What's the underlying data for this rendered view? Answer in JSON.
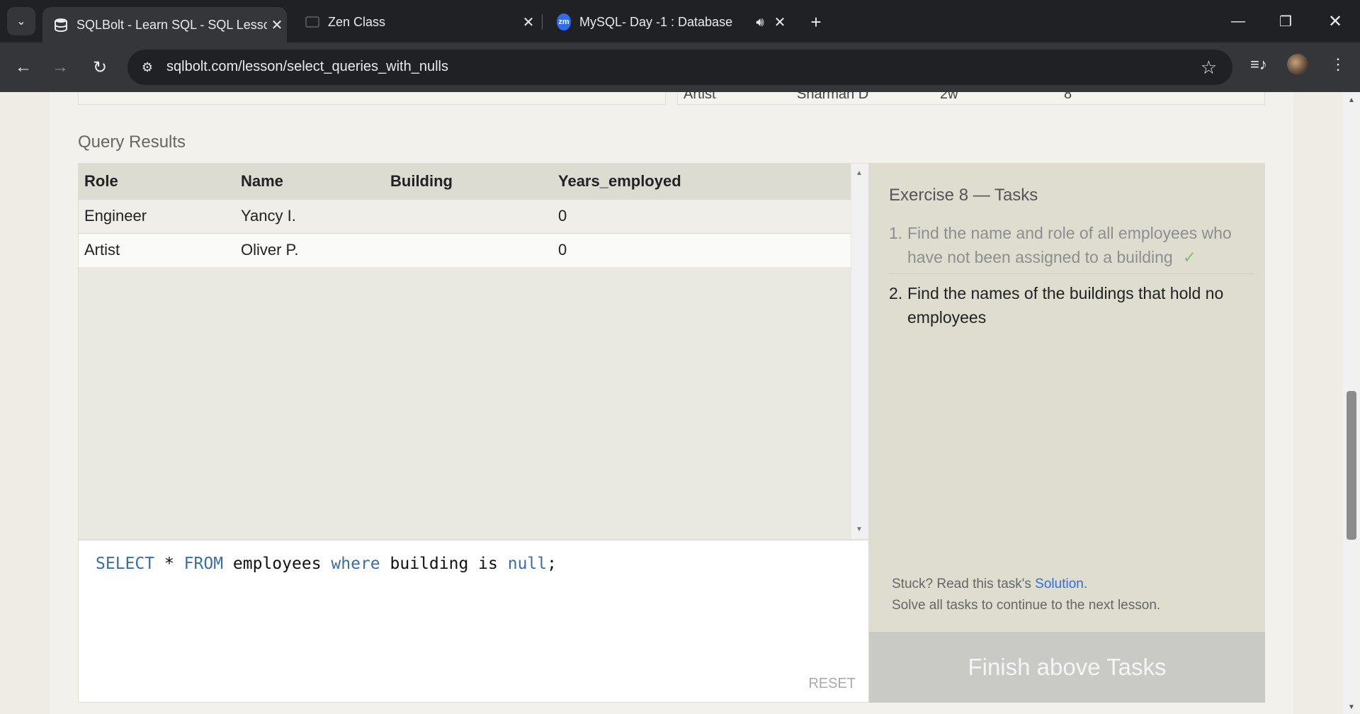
{
  "browser": {
    "tabs": [
      {
        "title": "SQLBolt - Learn SQL - SQL Lesso",
        "active": true
      },
      {
        "title": "Zen Class",
        "active": false
      },
      {
        "title": "MySQL- Day -1 : Database",
        "active": false
      }
    ],
    "url": "sqlbolt.com/lesson/select_queries_with_nulls",
    "zoom_favicon_label": "zm"
  },
  "previous_table": {
    "partial_row": [
      "Artist",
      "Sharman D",
      "2w",
      "8"
    ]
  },
  "results": {
    "label": "Query Results",
    "columns": [
      "Role",
      "Name",
      "Building",
      "Years_employed"
    ],
    "rows": [
      [
        "Engineer",
        "Yancy I.",
        "",
        "0"
      ],
      [
        "Artist",
        "Oliver P.",
        "",
        "0"
      ]
    ]
  },
  "editor": {
    "query_tokens": [
      "SELECT",
      "*",
      "FROM",
      "employees",
      "where",
      "building",
      "is",
      "null",
      ";"
    ],
    "reset_label": "RESET"
  },
  "tasks": {
    "title": "Exercise 8 — Tasks",
    "items": [
      {
        "num": "1.",
        "text": "Find the name and role of all employees who have not been assigned to a building",
        "done": true,
        "check": "✓"
      },
      {
        "num": "2.",
        "text": "Find the names of the buildings that hold no employees",
        "done": false
      }
    ],
    "stuck_prefix": "Stuck? Read this task's ",
    "solution_link": "Solution",
    "stuck_suffix": ".",
    "continue_text": "Solve all tasks to continue to the next lesson.",
    "finish_button": "Finish above Tasks"
  }
}
